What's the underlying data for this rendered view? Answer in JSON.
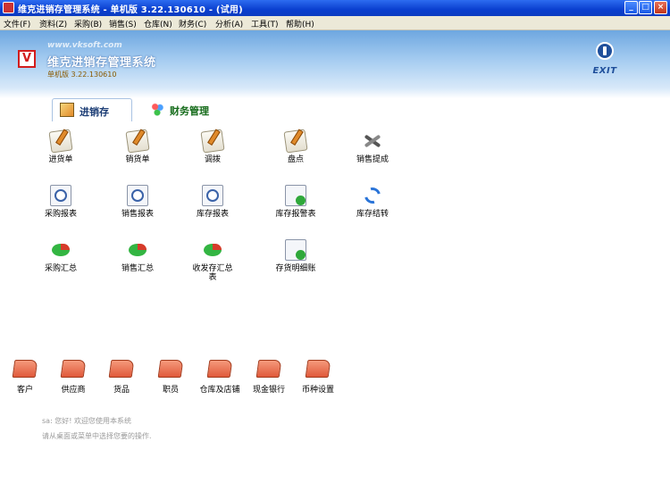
{
  "window": {
    "title": "维克进销存管理系统 - 单机版 3.22.130610 - (试用)",
    "buttons": {
      "minimize": "_",
      "maximize": "□",
      "close": "×"
    }
  },
  "menu": [
    "文件(F)",
    "资料(Z)",
    "采购(B)",
    "销售(S)",
    "仓库(N)",
    "财务(C)",
    "分析(A)",
    "工具(T)",
    "帮助(H)"
  ],
  "header": {
    "site": "www.vksoft.com",
    "app_title": "维克进销存管理系统",
    "version": "单机版 3.22.130610",
    "logo_letter": "V",
    "exit_label": "EXIT"
  },
  "tabs": [
    {
      "label": "进销存",
      "active": true,
      "icon": "invoice-icon"
    },
    {
      "label": "财务管理",
      "active": false,
      "icon": "finance-icon"
    }
  ],
  "modules": [
    {
      "label": "进货单",
      "icon": "edit-form-icon"
    },
    {
      "label": "销货单",
      "icon": "edit-form-icon"
    },
    {
      "label": "调拨",
      "icon": "edit-form-icon"
    },
    {
      "label": "盘点",
      "icon": "edit-form-icon"
    },
    {
      "label": "销售提成",
      "icon": "tools-icon"
    },
    {
      "label": "采购报表",
      "icon": "report-clock-icon"
    },
    {
      "label": "销售报表",
      "icon": "report-clock-icon"
    },
    {
      "label": "库存报表",
      "icon": "report-clock-icon"
    },
    {
      "label": "库存报警表",
      "icon": "report-alarm-icon"
    },
    {
      "label": "库存结转",
      "icon": "sync-icon"
    },
    {
      "label": "采购汇总",
      "icon": "pie-chart-icon"
    },
    {
      "label": "销售汇总",
      "icon": "pie-chart-icon"
    },
    {
      "label": "收发存汇总表",
      "icon": "pie-chart-icon"
    },
    {
      "label": "存货明细账",
      "icon": "report-alarm-icon"
    }
  ],
  "basics": [
    {
      "label": "客户",
      "icon": "folder-icon"
    },
    {
      "label": "供应商",
      "icon": "folder-icon"
    },
    {
      "label": "货品",
      "icon": "folder-icon"
    },
    {
      "label": "职员",
      "icon": "folder-icon"
    },
    {
      "label": "仓库及店铺",
      "icon": "folder-icon"
    },
    {
      "label": "现金银行",
      "icon": "folder-icon"
    },
    {
      "label": "币种设置",
      "icon": "folder-icon"
    }
  ],
  "status": {
    "greeting": "sa: 您好! 欢迎您使用本系统",
    "hint": "请从桌面或菜单中选择您要的操作."
  }
}
